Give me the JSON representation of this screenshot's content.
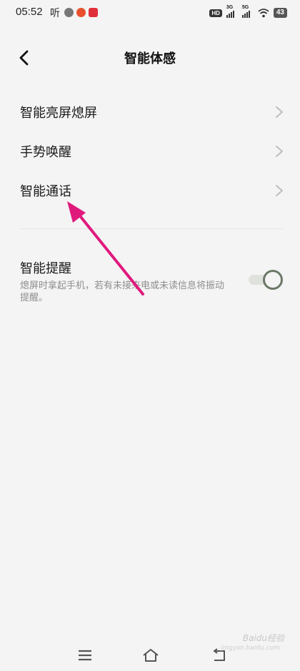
{
  "status_bar": {
    "time": "05:52",
    "ting_app": "听",
    "network_1": "3G",
    "network_2": "5G",
    "battery": "43",
    "hd_badge": "HD"
  },
  "header": {
    "title": "智能体感",
    "back_icon": "chevron-left-icon"
  },
  "menu": {
    "items": [
      {
        "label": "智能亮屏熄屏",
        "icon": "chevron-right-icon"
      },
      {
        "label": "手势唤醒",
        "icon": "chevron-right-icon"
      },
      {
        "label": "智能通话",
        "icon": "chevron-right-icon"
      }
    ]
  },
  "smart_reminder": {
    "title": "智能提醒",
    "description": "熄屏时拿起手机，若有未接来电或未读信息将振动提醒。",
    "enabled": true
  },
  "navigation_bar": {
    "icons": [
      "menu-icon",
      "home-icon",
      "back-icon"
    ]
  },
  "watermark": {
    "text": "Baidu经验",
    "sub": "jingyan.baidu.com"
  },
  "colors": {
    "background": "#f4f4f4",
    "annotation_arrow": "#e0197d",
    "switch_knob": "#6c7868"
  }
}
